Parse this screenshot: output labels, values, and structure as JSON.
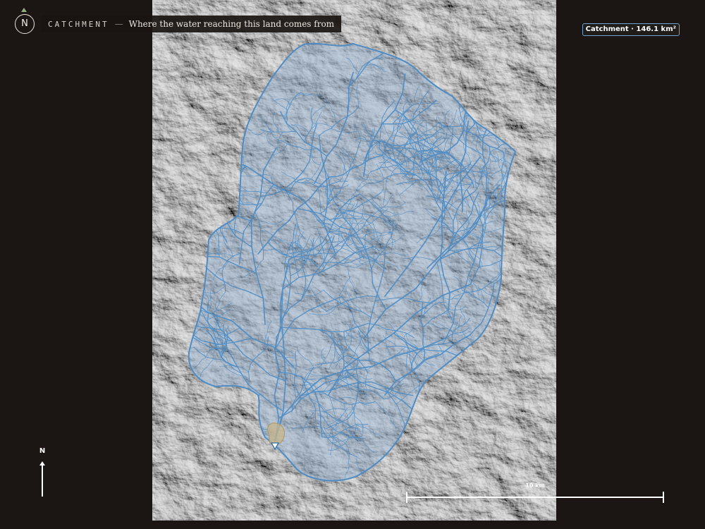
{
  "header": {
    "compass_letter": "N",
    "title_word": "CATCHMENT",
    "separator": "—",
    "subtitle": "Where the water reaching this land comes from"
  },
  "badge": {
    "label": "Catchment · 146.1 km²"
  },
  "north_arrow": {
    "label": "N"
  },
  "scale_bar": {
    "label": "10 km"
  },
  "map": {
    "layers": [
      "hillshade",
      "catchment-area",
      "stream-network",
      "outlet-marker"
    ],
    "colors": {
      "background": "#1b1613",
      "catchment_fill": "#7fa6cc",
      "catchment_outline": "#4f8cc4",
      "streams": "#4a8ac4",
      "outlet_area": "#c8b68a"
    },
    "icons": {
      "outlet": "triangle-down-icon"
    }
  }
}
